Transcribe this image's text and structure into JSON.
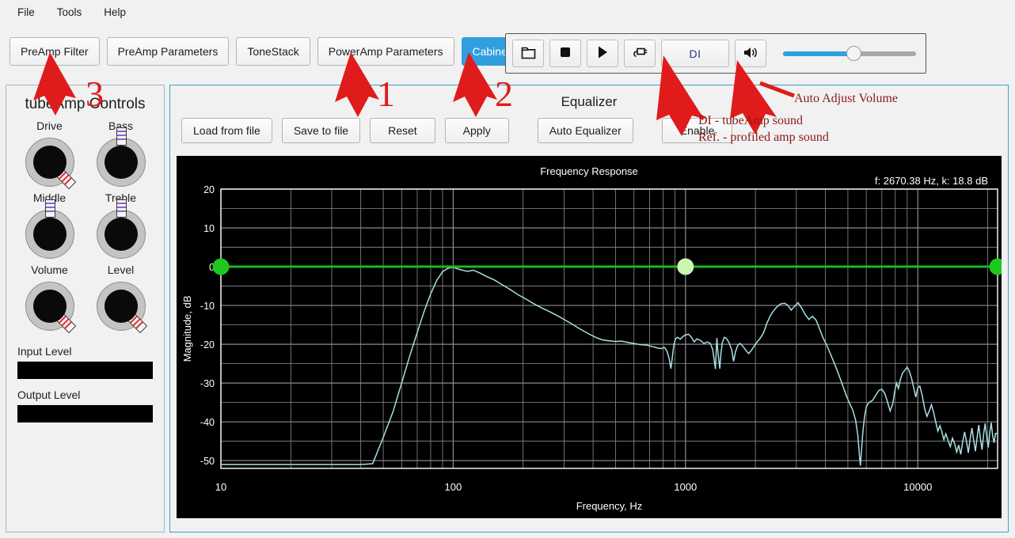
{
  "menu": {
    "items": [
      {
        "label": "File"
      },
      {
        "label": "Tools"
      },
      {
        "label": "Help"
      }
    ]
  },
  "tabs": [
    {
      "label": "PreAmp Filter",
      "active": false
    },
    {
      "label": "PreAmp Parameters",
      "active": false
    },
    {
      "label": "ToneStack",
      "active": false
    },
    {
      "label": "PowerAmp Parameters",
      "active": false
    },
    {
      "label": "Cabinet",
      "active": true
    }
  ],
  "transport": {
    "open_icon": "folder-open-icon",
    "stop_icon": "stop-icon",
    "play_icon": "play-icon",
    "plug_icon": "plug-icon",
    "di_label": "DI",
    "speaker_icon": "speaker-icon",
    "volume_percent": 53
  },
  "sidebar": {
    "title": "tubeAmp Controls",
    "knobs": [
      {
        "label": "Drive",
        "indicator": "down-right",
        "stripe_color": "#e03030"
      },
      {
        "label": "Bass",
        "indicator": "up",
        "stripe_color": "#8a66c8"
      },
      {
        "label": "Middle",
        "indicator": "up",
        "stripe_color": "#8a66c8"
      },
      {
        "label": "Treble",
        "indicator": "up",
        "stripe_color": "#8a66c8"
      },
      {
        "label": "Volume",
        "indicator": "down-right",
        "stripe_color": "#e03030"
      },
      {
        "label": "Level",
        "indicator": "down-right",
        "stripe_color": "#e03030"
      }
    ],
    "input_level_label": "Input Level",
    "output_level_label": "Output Level"
  },
  "equalizer": {
    "title": "Equalizer",
    "buttons": [
      {
        "label": "Load from file"
      },
      {
        "label": "Save to file"
      },
      {
        "label": "Reset"
      },
      {
        "label": "Apply"
      },
      {
        "label": "Auto Equalizer"
      },
      {
        "label": "Enable"
      }
    ],
    "readout": "f: 2670.38 Hz, k: 18.8 dB"
  },
  "annotations": {
    "number_one": "1",
    "number_two": "2",
    "number_three": "3",
    "auto_adjust_volume": "Auto Adjust Volume",
    "di_note": "DI - tubeAmp sound",
    "ref_note": "Ref. - profiled amp sound"
  },
  "chart_data": {
    "type": "line",
    "title": "Frequency Response",
    "xlabel": "Frequency, Hz",
    "ylabel": "Magnitude, dB",
    "xscale": "log",
    "xlim": [
      10,
      22050
    ],
    "ylim": [
      -52,
      20
    ],
    "xticks": [
      10,
      100,
      1000,
      10000
    ],
    "xtick_labels": [
      "10",
      "100",
      "1000",
      "10000"
    ],
    "yticks": [
      20,
      10,
      0,
      -10,
      -20,
      -30,
      -40,
      -50
    ],
    "ytick_labels": [
      "20",
      "10",
      "0",
      "-10",
      "-20",
      "-30",
      "-40",
      "-50"
    ],
    "grid": true,
    "grid_minor_y_step": 5,
    "background": "#000000",
    "series": [
      {
        "name": "Frequency Response",
        "color": "#a9dfe4",
        "points": [
          [
            10,
            -51.0
          ],
          [
            20,
            -51.0
          ],
          [
            30,
            -51.0
          ],
          [
            40,
            -51.0
          ],
          [
            45,
            -50.8
          ],
          [
            50,
            -44.0
          ],
          [
            55,
            -37.5
          ],
          [
            60,
            -30.0
          ],
          [
            65,
            -23.0
          ],
          [
            70,
            -17.0
          ],
          [
            75,
            -11.5
          ],
          [
            80,
            -7.0
          ],
          [
            85,
            -3.5
          ],
          [
            90,
            -1.3
          ],
          [
            95,
            -0.4
          ],
          [
            100,
            -0.2
          ],
          [
            108,
            -0.8
          ],
          [
            115,
            -1.2
          ],
          [
            122,
            -0.9
          ],
          [
            130,
            -1.6
          ],
          [
            140,
            -2.6
          ],
          [
            150,
            -3.4
          ],
          [
            160,
            -4.4
          ],
          [
            175,
            -5.8
          ],
          [
            190,
            -7.2
          ],
          [
            205,
            -8.3
          ],
          [
            220,
            -9.4
          ],
          [
            240,
            -10.6
          ],
          [
            260,
            -11.6
          ],
          [
            280,
            -12.6
          ],
          [
            300,
            -13.6
          ],
          [
            325,
            -14.8
          ],
          [
            350,
            -16.0
          ],
          [
            380,
            -17.2
          ],
          [
            410,
            -18.2
          ],
          [
            440,
            -18.9
          ],
          [
            470,
            -19.1
          ],
          [
            500,
            -19.3
          ],
          [
            530,
            -19.2
          ],
          [
            560,
            -19.5
          ],
          [
            600,
            -19.8
          ],
          [
            640,
            -20.1
          ],
          [
            680,
            -20.2
          ],
          [
            720,
            -20.6
          ],
          [
            760,
            -21.0
          ],
          [
            790,
            -21.1
          ],
          [
            810,
            -20.8
          ],
          [
            830,
            -21.6
          ],
          [
            850,
            -23.6
          ],
          [
            865,
            -26.3
          ],
          [
            875,
            -24.0
          ],
          [
            890,
            -20.3
          ],
          [
            905,
            -18.6
          ],
          [
            925,
            -18.2
          ],
          [
            950,
            -18.7
          ],
          [
            975,
            -18.0
          ],
          [
            1000,
            -17.6
          ],
          [
            1030,
            -17.4
          ],
          [
            1060,
            -18.2
          ],
          [
            1090,
            -19.4
          ],
          [
            1120,
            -18.6
          ],
          [
            1160,
            -19.0
          ],
          [
            1200,
            -19.8
          ],
          [
            1240,
            -19.4
          ],
          [
            1280,
            -19.8
          ],
          [
            1310,
            -21.4
          ],
          [
            1330,
            -24.3
          ],
          [
            1345,
            -26.4
          ],
          [
            1355,
            -22.0
          ],
          [
            1365,
            -18.4
          ],
          [
            1375,
            -21.2
          ],
          [
            1390,
            -24.0
          ],
          [
            1405,
            -26.3
          ],
          [
            1420,
            -22.5
          ],
          [
            1440,
            -19.6
          ],
          [
            1470,
            -18.2
          ],
          [
            1500,
            -18.5
          ],
          [
            1540,
            -19.6
          ],
          [
            1580,
            -21.4
          ],
          [
            1610,
            -24.4
          ],
          [
            1640,
            -22.0
          ],
          [
            1680,
            -20.2
          ],
          [
            1720,
            -19.8
          ],
          [
            1770,
            -20.6
          ],
          [
            1820,
            -21.6
          ],
          [
            1870,
            -22.4
          ],
          [
            1920,
            -21.6
          ],
          [
            1980,
            -20.4
          ],
          [
            2040,
            -19.3
          ],
          [
            2100,
            -18.4
          ],
          [
            2170,
            -17.0
          ],
          [
            2240,
            -14.6
          ],
          [
            2320,
            -12.6
          ],
          [
            2400,
            -11.3
          ],
          [
            2480,
            -10.3
          ],
          [
            2570,
            -9.6
          ],
          [
            2670,
            -9.4
          ],
          [
            2760,
            -10.0
          ],
          [
            2850,
            -11.2
          ],
          [
            2950,
            -10.2
          ],
          [
            3050,
            -9.3
          ],
          [
            3150,
            -10.5
          ],
          [
            3280,
            -12.4
          ],
          [
            3400,
            -13.6
          ],
          [
            3520,
            -12.8
          ],
          [
            3650,
            -13.8
          ],
          [
            3780,
            -16.1
          ],
          [
            3900,
            -18.2
          ],
          [
            4050,
            -20.2
          ],
          [
            4200,
            -22.4
          ],
          [
            4350,
            -24.6
          ],
          [
            4500,
            -26.8
          ],
          [
            4650,
            -29.1
          ],
          [
            4800,
            -31.4
          ],
          [
            4950,
            -33.6
          ],
          [
            5100,
            -35.4
          ],
          [
            5250,
            -37.0
          ],
          [
            5400,
            -39.6
          ],
          [
            5520,
            -43.6
          ],
          [
            5600,
            -48.2
          ],
          [
            5660,
            -51.3
          ],
          [
            5720,
            -47.6
          ],
          [
            5800,
            -42.6
          ],
          [
            5900,
            -38.6
          ],
          [
            6000,
            -36.2
          ],
          [
            6120,
            -35.2
          ],
          [
            6250,
            -34.8
          ],
          [
            6400,
            -34.4
          ],
          [
            6600,
            -33.1
          ],
          [
            6800,
            -31.9
          ],
          [
            7000,
            -31.6
          ],
          [
            7200,
            -32.6
          ],
          [
            7400,
            -34.8
          ],
          [
            7600,
            -37.2
          ],
          [
            7800,
            -35.4
          ],
          [
            7950,
            -32.2
          ],
          [
            8100,
            -30.0
          ],
          [
            8250,
            -31.4
          ],
          [
            8400,
            -29.2
          ],
          [
            8600,
            -27.4
          ],
          [
            8800,
            -26.7
          ],
          [
            9000,
            -25.9
          ],
          [
            9200,
            -27.0
          ],
          [
            9400,
            -28.8
          ],
          [
            9600,
            -31.2
          ],
          [
            9800,
            -33.6
          ],
          [
            10000,
            -31.2
          ],
          [
            10200,
            -30.8
          ],
          [
            10450,
            -33.2
          ],
          [
            10700,
            -36.6
          ],
          [
            10950,
            -38.6
          ],
          [
            11200,
            -37.2
          ],
          [
            11450,
            -35.6
          ],
          [
            11700,
            -37.6
          ],
          [
            11950,
            -40.1
          ],
          [
            12200,
            -42.4
          ],
          [
            12450,
            -41.0
          ],
          [
            12700,
            -42.6
          ],
          [
            12950,
            -44.6
          ],
          [
            13200,
            -43.1
          ],
          [
            13500,
            -44.8
          ],
          [
            13800,
            -46.4
          ],
          [
            14100,
            -44.2
          ],
          [
            14400,
            -45.6
          ],
          [
            14700,
            -47.8
          ],
          [
            15000,
            -46.0
          ],
          [
            15300,
            -48.4
          ],
          [
            15600,
            -45.2
          ],
          [
            15900,
            -42.6
          ],
          [
            16200,
            -45.0
          ],
          [
            16500,
            -48.0
          ],
          [
            16800,
            -44.4
          ],
          [
            17100,
            -41.6
          ],
          [
            17400,
            -44.8
          ],
          [
            17700,
            -47.6
          ],
          [
            18000,
            -44.0
          ],
          [
            18300,
            -40.8
          ],
          [
            18600,
            -44.4
          ],
          [
            18900,
            -47.2
          ],
          [
            19200,
            -43.2
          ],
          [
            19500,
            -40.4
          ],
          [
            19800,
            -43.8
          ],
          [
            20100,
            -46.6
          ],
          [
            20400,
            -42.8
          ],
          [
            20700,
            -40.2
          ],
          [
            21000,
            -43.6
          ],
          [
            21300,
            -45.4
          ],
          [
            21600,
            -43.0
          ],
          [
            22050,
            -43.0
          ]
        ]
      }
    ],
    "eq_curve": {
      "name": "Equalizer curve",
      "color": "#1db81d",
      "values": [
        [
          10,
          0
        ],
        [
          1000,
          0
        ],
        [
          22050,
          0
        ]
      ]
    },
    "handles": [
      {
        "freq": 10,
        "db": 0,
        "color": "#1ec81e",
        "selected": false
      },
      {
        "freq": 1000,
        "db": 0,
        "color": "#ccf5b0",
        "selected": true
      },
      {
        "freq": 22050,
        "db": 0,
        "color": "#1ec81e",
        "selected": false
      }
    ]
  }
}
